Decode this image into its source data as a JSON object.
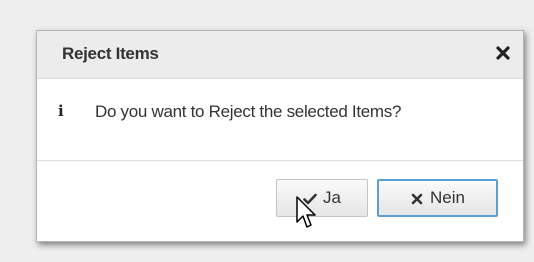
{
  "dialog": {
    "title": "Reject Items",
    "close_icon": "close-icon",
    "message_icon": "info-icon",
    "message": "Do you want to Reject the selected Items?",
    "buttons": {
      "yes_label": "Ja",
      "yes_icon": "checkmark-icon",
      "no_label": "Nein",
      "no_icon": "x-icon"
    }
  },
  "colors": {
    "header_bg": "#ececec",
    "focus_border": "#5aa0d8",
    "text": "#333333"
  }
}
